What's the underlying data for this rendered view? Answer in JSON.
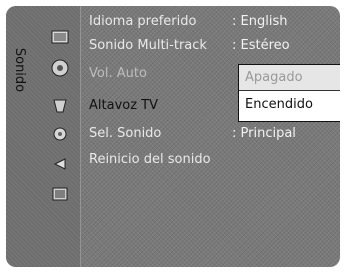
{
  "sidebar": {
    "label": "Sonido",
    "icons": [
      "picture-icon",
      "sound-icon",
      "channel-icon",
      "setup-icon",
      "input-icon",
      "application-icon"
    ]
  },
  "menu": {
    "rows": [
      {
        "label": "Idioma preferido",
        "value": ": English"
      },
      {
        "label": "Sonido Multi-track",
        "value": ": Estéreo"
      },
      {
        "label": "Vol. Auto",
        "value": ""
      },
      {
        "label": "Altavoz TV",
        "value": ""
      },
      {
        "label": "Sel. Sonido",
        "value": ": Principal"
      },
      {
        "label": "Reinicio del sonido",
        "value": ""
      }
    ]
  },
  "dropdown": {
    "options": [
      "Apagado",
      "Encendido"
    ],
    "selected": "Encendido"
  }
}
